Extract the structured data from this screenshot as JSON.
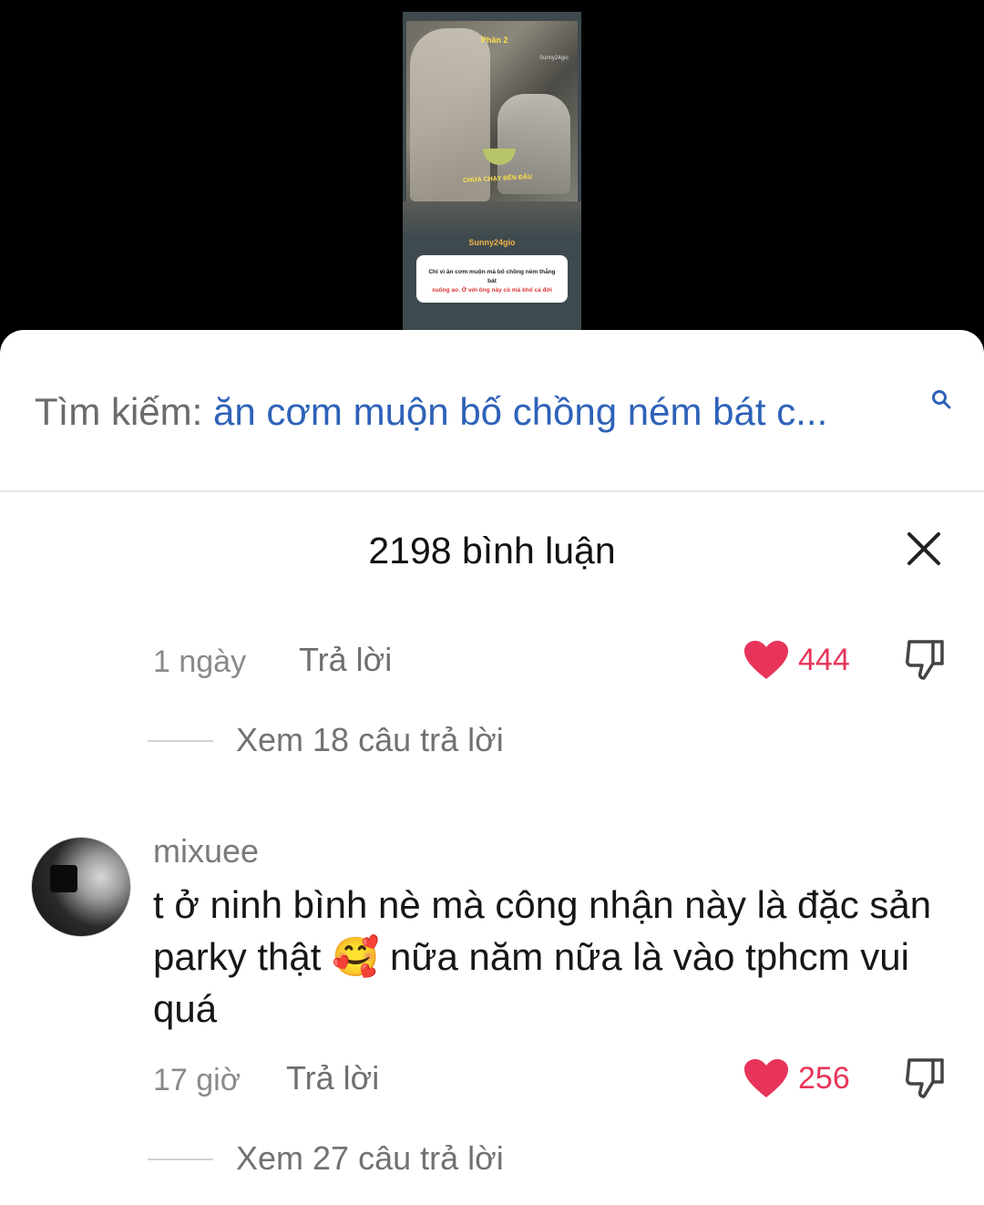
{
  "video": {
    "part_label": "Phần 2",
    "watermark": "Sunny24gio",
    "subtitle": "CHƯA CHẠY ĐẾN ĐÂU",
    "brand": "Sunny24gio",
    "caption_line1": "Chỉ vì ăn cơm muộn mà bố chồng ném thẳng bát",
    "caption_line2": "xuống ao. Ở với ông này có mà khổ cả đời"
  },
  "search": {
    "prefix": "Tìm kiếm: ",
    "query": "ăn cơm muộn bố chồng ném bát c...",
    "icon": "search-icon"
  },
  "comments_header": {
    "count_label": "2198 bình luận",
    "close_icon": "close-icon"
  },
  "comments": [
    {
      "time": "1 ngày",
      "reply_label": "Trả lời",
      "likes": "444",
      "view_replies": "Xem 18 câu trả lời"
    },
    {
      "username": "mixuee",
      "text": "t ở ninh bình nè mà công nhận này là đặc sản parky thật 🥰 nữa năm nữa là vào tphcm vui quá",
      "time": "17 giờ",
      "reply_label": "Trả lời",
      "likes": "256",
      "view_replies": "Xem 27 câu trả lời"
    }
  ],
  "colors": {
    "like": "#e8345a",
    "search_query": "#2e62b8"
  }
}
